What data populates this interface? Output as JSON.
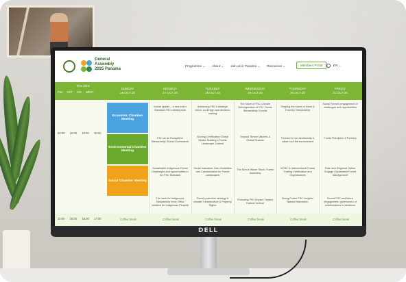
{
  "site": {
    "event_name_line1": "General",
    "event_name_line2": "Assembly",
    "event_name_line3": "2025 Panama"
  },
  "nav": {
    "items": [
      {
        "label": "Programme ⌄"
      },
      {
        "label": "About ⌄"
      },
      {
        "label": "Join us in Panama ⌄"
      },
      {
        "label": "Resources ⌄"
      }
    ],
    "members_portal": "Members Portal",
    "language": "EN ⌄"
  },
  "table": {
    "timezone_header": "Time Zone",
    "tz_columns": [
      "Pan",
      "CET",
      "CIS",
      "WEST"
    ],
    "days": [
      {
        "day": "SUNDAY",
        "date": "26.OCT.25"
      },
      {
        "day": "MONDAY",
        "date": "27.OCT.25"
      },
      {
        "day": "TUESDAY",
        "date": "28.OCT.25"
      },
      {
        "day": "WEDNESDAY",
        "date": "29.OCT.25"
      },
      {
        "day": "THURSDAY",
        "date": "30.OCT.25"
      },
      {
        "day": "FRIDAY",
        "date": "31.OCT.25"
      }
    ],
    "rows": [
      {
        "times": [
          "08:00",
          "15:00",
          "16:00",
          "15:00"
        ],
        "chamber": "Economic Chamber Meeting",
        "cells": [
          "Global update – a new era in Standard FSC-related work",
          "Advancing FSC's strategic vision: co-design and decision-making",
          "The future of FSC Climate Reinvigoration of FSC Forest Stewardship Council",
          "Shaping the future of forest & Forestry Stewardship",
          "Social Forest's engagement of challenges and opportunities"
        ]
      },
      {
        "chamber": "Environmental Chamber Meeting",
        "cells": [
          "FSC as an Ecosystem Stewardship Global Governance",
          "Scoring Certification Global Model: Building a Forest Landscape Context",
          "Tropical Timber Markets & Global Finance",
          "Forests for our biodiversity & value: tool the environment",
          "Forest Principles of Forestry"
        ]
      },
      {
        "chamber": "Social Chamber Meeting",
        "cells": [
          "Sustainable Indigenous Forest Challenges and opportunities in the FSC Standard",
          "Social Indicators: Non-Modalities and Customization for Forest Landscapes",
          "The Bonus Waver Stock: Forest Assembly",
          "NORC & Intersectional Forest Trading Certification and Organisations",
          "Rate new Regional Option Engage Sustainable Forest Management"
        ]
      },
      {
        "cells": [
          "The case for Indigenous Stewardship Inner Office Initiative for Indigenous Peoples",
          "Forest protection strategy & climate: Infrastructure & Property Rights",
          "Financing FSC Impact: Toward Fastest Vertical",
          "Sizing Future FSC Insights: Natural Interaction",
          "Sound FSC and future engagement: government of collaborations in decisions"
        ]
      }
    ],
    "last_row_times": [
      "10:00",
      "18:00",
      "18:00",
      "17:00"
    ],
    "coffee_label": "Coffee break"
  },
  "device": {
    "brand": "DELL"
  },
  "colors": {
    "header_green": "#7db534",
    "economic": "#4aa3df",
    "environmental": "#6aaa2e",
    "social": "#f0a21a"
  }
}
